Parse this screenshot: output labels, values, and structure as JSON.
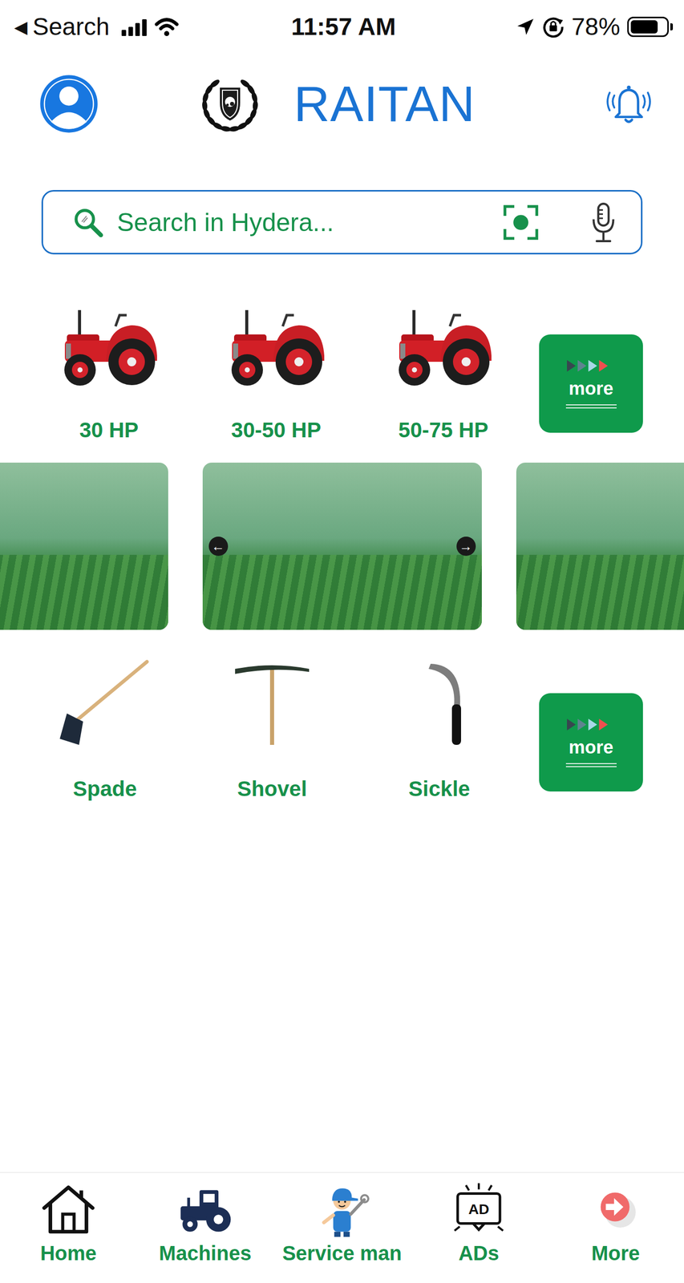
{
  "status_bar": {
    "back_icon": "◀",
    "back_label": "Search",
    "time": "11:57 AM",
    "battery": "78%",
    "battery_level": 0.78
  },
  "header": {
    "title": "RAITAN"
  },
  "search": {
    "placeholder": "Search in Hydera..."
  },
  "tractor_categories": {
    "items": [
      {
        "label": "30 HP"
      },
      {
        "label": "30-50 HP"
      },
      {
        "label": "50-75 HP"
      }
    ],
    "more": "more"
  },
  "banners": {
    "prev": "←",
    "next": "→",
    "slides": [
      {
        "selected": false
      },
      {
        "selected": true
      },
      {
        "selected": false
      }
    ]
  },
  "tools": {
    "items": [
      {
        "label": "Spade",
        "kind": "hoe"
      },
      {
        "label": "Shovel",
        "kind": "pickaxe"
      },
      {
        "label": "Sickle",
        "kind": "sickle"
      }
    ],
    "more": "more"
  },
  "nav": [
    {
      "label": "Home",
      "kind": "home"
    },
    {
      "label": "Machines",
      "kind": "tractor"
    },
    {
      "label": "Service man",
      "kind": "mechanic"
    },
    {
      "label": "ADs",
      "kind": "ad",
      "badge": "AD"
    },
    {
      "label": "More",
      "kind": "exit"
    }
  ]
}
